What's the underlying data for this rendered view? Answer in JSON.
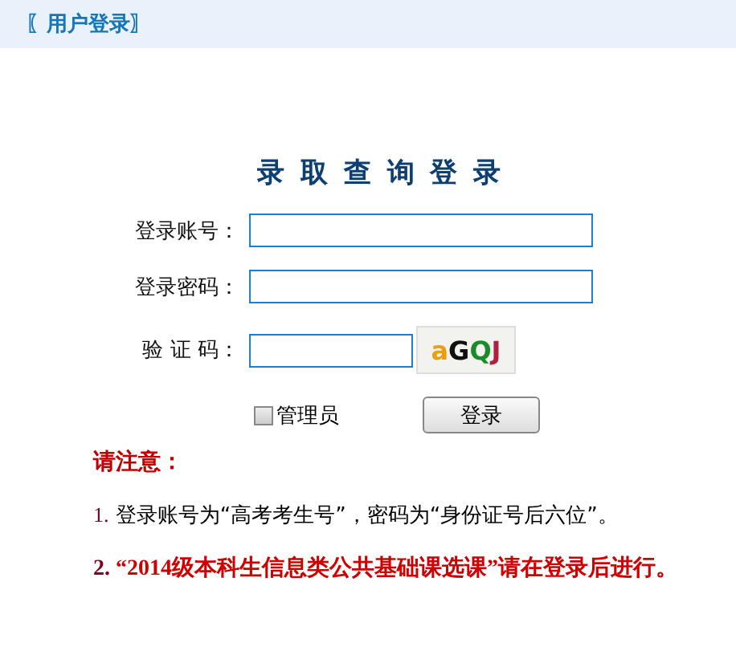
{
  "header": {
    "title": "〖用户登录〗"
  },
  "form_title": "录 取 查 询 登 录",
  "fields": [
    {
      "label": "登录账号：",
      "kind": "text"
    },
    {
      "label": "登录密码：",
      "kind": "password"
    },
    {
      "label": "验 证 码：",
      "kind": "captcha"
    }
  ],
  "captcha": "aGQJ",
  "admin": {
    "label": "管理员",
    "checked": false
  },
  "login_button": "登录",
  "notice": {
    "heading": "请注意：",
    "items": [
      {
        "number": "1.",
        "text": "登录账号为“高考考生号”，密码为“身份证号后六位”。",
        "kind": "plain"
      },
      {
        "number": "2.",
        "text": "“2014级本科生信息类公共基础课选课”请在登录后进行。",
        "kind": "alert"
      }
    ]
  }
}
